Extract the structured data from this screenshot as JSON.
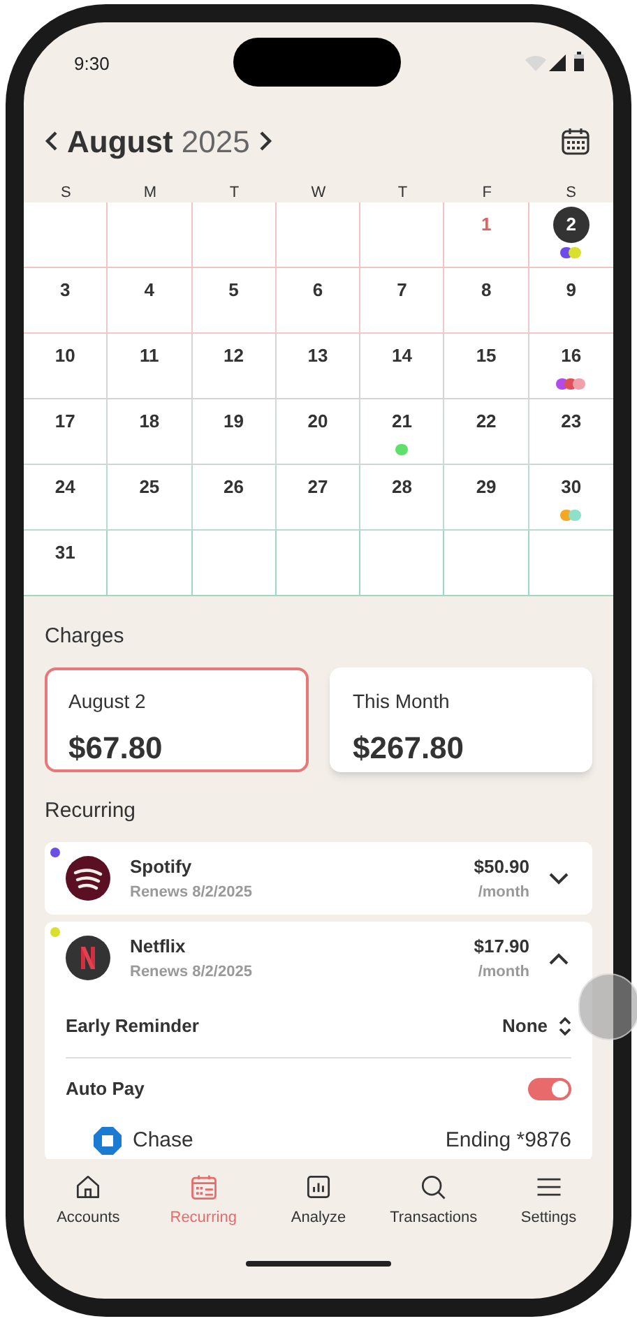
{
  "status_bar": {
    "time": "9:30"
  },
  "header": {
    "month": "August",
    "year": "2025"
  },
  "weekdays": [
    "S",
    "M",
    "T",
    "W",
    "T",
    "F",
    "S"
  ],
  "weeks": [
    [
      {
        "kind": "blank"
      },
      {
        "kind": "blank"
      },
      {
        "kind": "blank"
      },
      {
        "kind": "blank"
      },
      {
        "kind": "blank"
      },
      {
        "kind": "day",
        "day": "1",
        "accent": true,
        "selected": false
      },
      {
        "kind": "day",
        "day": "2",
        "accent": false,
        "selected": true,
        "dots": [
          {
            "color": "#6d4de8"
          },
          {
            "color": "#d8e02c"
          }
        ]
      }
    ],
    [
      {
        "kind": "day",
        "day": "3",
        "accent": false,
        "selected": false
      },
      {
        "kind": "day",
        "day": "4",
        "accent": false,
        "selected": false
      },
      {
        "kind": "day",
        "day": "5",
        "accent": false,
        "selected": false
      },
      {
        "kind": "day",
        "day": "6",
        "accent": false,
        "selected": false
      },
      {
        "kind": "day",
        "day": "7",
        "accent": false,
        "selected": false
      },
      {
        "kind": "day",
        "day": "8",
        "accent": false,
        "selected": false
      },
      {
        "kind": "day",
        "day": "9",
        "accent": false,
        "selected": false
      }
    ],
    [
      {
        "kind": "day",
        "day": "10",
        "accent": false,
        "selected": false
      },
      {
        "kind": "day",
        "day": "11",
        "accent": false,
        "selected": false
      },
      {
        "kind": "day",
        "day": "12",
        "accent": false,
        "selected": false
      },
      {
        "kind": "day",
        "day": "13",
        "accent": false,
        "selected": false
      },
      {
        "kind": "day",
        "day": "14",
        "accent": false,
        "selected": false
      },
      {
        "kind": "day",
        "day": "15",
        "accent": false,
        "selected": false
      },
      {
        "kind": "day",
        "day": "16",
        "accent": false,
        "selected": false,
        "dots": [
          {
            "color": "#b04ce8"
          },
          {
            "color": "#e0505a"
          },
          {
            "color": "#f0a0a8"
          }
        ]
      }
    ],
    [
      {
        "kind": "day",
        "day": "17",
        "accent": false,
        "selected": false
      },
      {
        "kind": "day",
        "day": "18",
        "accent": false,
        "selected": false
      },
      {
        "kind": "day",
        "day": "19",
        "accent": false,
        "selected": false
      },
      {
        "kind": "day",
        "day": "20",
        "accent": false,
        "selected": false
      },
      {
        "kind": "day",
        "day": "21",
        "accent": false,
        "selected": false,
        "dots": [
          {
            "color": "#5ee06a"
          }
        ]
      },
      {
        "kind": "day",
        "day": "22",
        "accent": false,
        "selected": false
      },
      {
        "kind": "day",
        "day": "23",
        "accent": false,
        "selected": false
      }
    ],
    [
      {
        "kind": "day",
        "day": "24",
        "accent": false,
        "selected": false
      },
      {
        "kind": "day",
        "day": "25",
        "accent": false,
        "selected": false
      },
      {
        "kind": "day",
        "day": "26",
        "accent": false,
        "selected": false
      },
      {
        "kind": "day",
        "day": "27",
        "accent": false,
        "selected": false
      },
      {
        "kind": "day",
        "day": "28",
        "accent": false,
        "selected": false
      },
      {
        "kind": "day",
        "day": "29",
        "accent": false,
        "selected": false
      },
      {
        "kind": "day",
        "day": "30",
        "accent": false,
        "selected": false,
        "dots": [
          {
            "color": "#f5a623"
          },
          {
            "color": "#8ee0c8"
          }
        ]
      }
    ],
    [
      {
        "kind": "day",
        "day": "31",
        "accent": false,
        "selected": false
      },
      {
        "kind": "blank"
      },
      {
        "kind": "blank"
      },
      {
        "kind": "blank"
      },
      {
        "kind": "blank"
      },
      {
        "kind": "blank"
      },
      {
        "kind": "blank"
      }
    ]
  ],
  "charges": {
    "title": "Charges",
    "cards": [
      {
        "label": "August 2",
        "amount": "$67.80",
        "selected": true
      },
      {
        "label": "This Month",
        "amount": "$267.80",
        "selected": false
      }
    ]
  },
  "recurring": {
    "title": "Recurring",
    "items": [
      {
        "kind": "spotify",
        "name": "Spotify",
        "renews": "Renews 8/2/2025",
        "price": "$50.90",
        "period": "/month",
        "color": "#6d4de8",
        "expanded": false
      },
      {
        "kind": "netflix",
        "name": "Netflix",
        "renews": "Renews 8/2/2025",
        "price": "$17.90",
        "period": "/month",
        "color": "#d8e02c",
        "expanded": true,
        "details": {
          "reminder_label": "Early Reminder",
          "reminder_value": "None",
          "autopay_label": "Auto Pay",
          "autopay_on": true,
          "bank": "Chase",
          "account": "Ending *9876"
        }
      }
    ]
  },
  "tabs": [
    {
      "label": "Accounts",
      "selected": false
    },
    {
      "label": "Recurring",
      "selected": true
    },
    {
      "label": "Analyze",
      "selected": false
    },
    {
      "label": "Transactions",
      "selected": false
    },
    {
      "label": "Settings",
      "selected": false
    }
  ]
}
